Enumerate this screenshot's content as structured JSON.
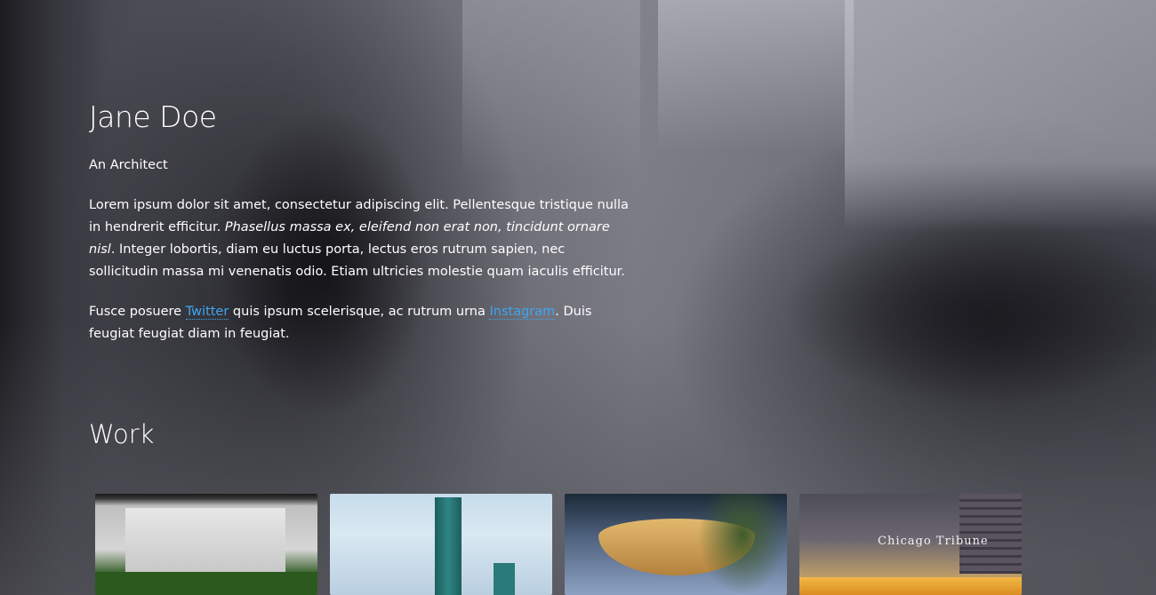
{
  "profile": {
    "name": "Jane Doe",
    "role": "An Architect"
  },
  "about": {
    "p1_start": "Lorem ipsum dolor sit amet, consectetur adipiscing elit. Pellentesque tristique nulla in hendrerit efficitur. ",
    "p1_italic": "Phasellus massa ex, eleifend non erat non, tincidunt ornare nisl",
    "p1_end": ". Integer lobortis, diam eu luctus porta, lectus eros rutrum sapien, nec sollicitudin massa mi venenatis odio. Etiam ultricies molestie quam iaculis efficitur.",
    "p2_start": "Fusce posuere ",
    "twitter_label": "Twitter",
    "p2_middle": " quis ipsum scelerisque, ac rutrum urna ",
    "instagram_label": "Instagram",
    "p2_end": ". Duis feugiat feugiat diam in feugiat."
  },
  "work": {
    "heading": "Work",
    "items": [
      {
        "icon": "apple-logo"
      },
      {
        "icon": "tower"
      },
      {
        "icon": "canopy"
      },
      {
        "sign": "Chicago Tribune"
      }
    ]
  },
  "colors": {
    "link": "#3ea7f0",
    "text": "#ffffff"
  }
}
